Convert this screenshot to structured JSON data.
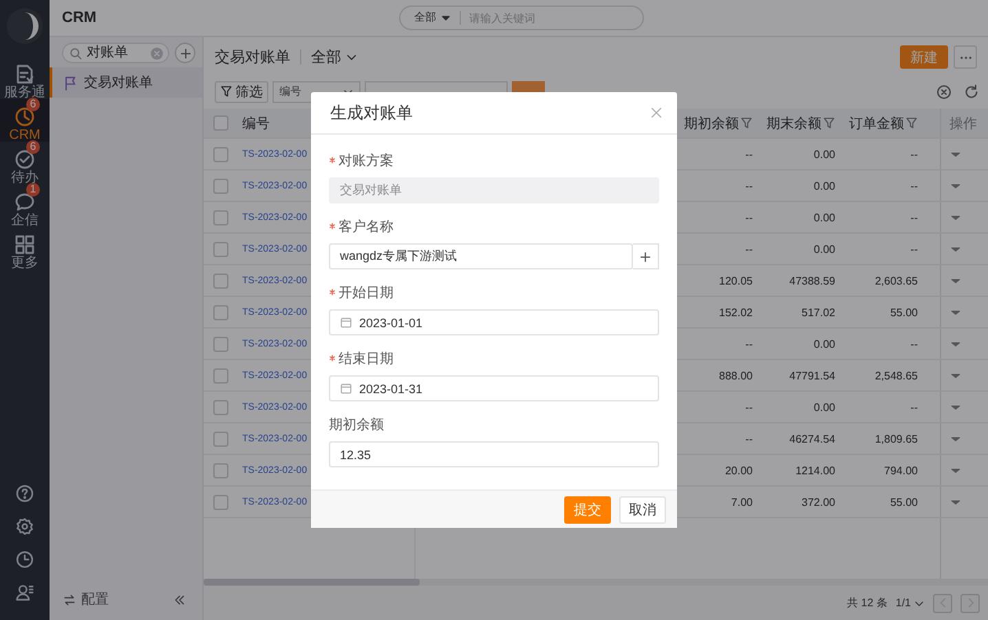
{
  "app_title": "CRM",
  "global_search": {
    "scope": "全部",
    "placeholder": "请输入关键词"
  },
  "rail": {
    "items": [
      {
        "kind": "doc",
        "label": "服务通",
        "selected": false
      },
      {
        "kind": "crm",
        "label": "CRM",
        "selected": true,
        "badge": "6"
      },
      {
        "kind": "todo",
        "label": "待办",
        "selected": false,
        "badge": "6"
      },
      {
        "kind": "chat",
        "label": "企信",
        "selected": false,
        "badge": "1"
      },
      {
        "kind": "grid",
        "label": "更多",
        "selected": false
      }
    ],
    "bottom_icons": [
      {
        "kind": "help"
      },
      {
        "kind": "settings"
      },
      {
        "kind": "history"
      },
      {
        "kind": "contacts"
      }
    ]
  },
  "object_panel": {
    "search": {
      "value": "对账单"
    },
    "items": [
      {
        "label": "交易对账单",
        "selected": true
      }
    ],
    "footer": {
      "label": "配置"
    }
  },
  "view": {
    "title": "交易对账单",
    "scope": "全部",
    "new_button": "新建",
    "toolbar": {
      "filter": "筛选",
      "field": "编号"
    }
  },
  "table": {
    "header_checked": false,
    "columns": [
      {
        "label": "编号",
        "filter": false
      },
      {
        "label": "期初余额",
        "filter": true
      },
      {
        "label": "期末余额",
        "filter": true
      },
      {
        "label": "订单金额",
        "filter": true
      },
      {
        "label": "操作",
        "filter": false
      }
    ],
    "rows": [
      {
        "checked": false,
        "id": "TS-2023-02-00",
        "cells": [
          "--",
          "0.00",
          "--"
        ]
      },
      {
        "checked": false,
        "id": "TS-2023-02-00",
        "cells": [
          "--",
          "0.00",
          "--"
        ]
      },
      {
        "checked": false,
        "id": "TS-2023-02-00",
        "cells": [
          "--",
          "0.00",
          "--"
        ]
      },
      {
        "checked": false,
        "id": "TS-2023-02-00",
        "cells": [
          "--",
          "0.00",
          "--"
        ]
      },
      {
        "checked": false,
        "id": "TS-2023-02-00",
        "cells": [
          "120.05",
          "47388.59",
          "2,603.65"
        ]
      },
      {
        "checked": false,
        "id": "TS-2023-02-00",
        "cells": [
          "152.02",
          "517.02",
          "55.00"
        ]
      },
      {
        "checked": false,
        "id": "TS-2023-02-00",
        "cells": [
          "--",
          "0.00",
          "--"
        ]
      },
      {
        "checked": false,
        "id": "TS-2023-02-00",
        "cells": [
          "888.00",
          "47791.54",
          "2,548.65"
        ]
      },
      {
        "checked": false,
        "id": "TS-2023-02-00",
        "cells": [
          "--",
          "0.00",
          "--"
        ]
      },
      {
        "checked": false,
        "id": "TS-2023-02-00",
        "cells": [
          "--",
          "46274.54",
          "1,809.65"
        ]
      },
      {
        "checked": false,
        "id": "TS-2023-02-00",
        "cells": [
          "20.00",
          "1214.00",
          "794.00"
        ]
      },
      {
        "checked": false,
        "id": "TS-2023-02-00",
        "cells": [
          "7.00",
          "372.00",
          "55.00"
        ]
      }
    ]
  },
  "pagination": {
    "total": "共 12 条",
    "page": "1/1",
    "prev": {
      "disabled": true
    },
    "next": {
      "disabled": true
    }
  },
  "dialog": {
    "title": "生成对账单",
    "fields": [
      {
        "kind": "text",
        "label": "对账方案",
        "required": true,
        "disabled": true,
        "value": "交易对账单"
      },
      {
        "kind": "lookup",
        "label": "客户名称",
        "required": true,
        "disabled": false,
        "value": "wangdz专属下游测试"
      },
      {
        "kind": "date",
        "label": "开始日期",
        "required": true,
        "disabled": false,
        "value": "2023-01-01"
      },
      {
        "kind": "date",
        "label": "结束日期",
        "required": true,
        "disabled": false,
        "value": "2023-01-31"
      },
      {
        "kind": "text",
        "label": "期初余额",
        "required": false,
        "disabled": false,
        "value": "12.35"
      }
    ],
    "buttons": [
      {
        "kind": "primary",
        "label": "提交"
      },
      {
        "kind": "secondary",
        "label": "取消"
      }
    ]
  }
}
